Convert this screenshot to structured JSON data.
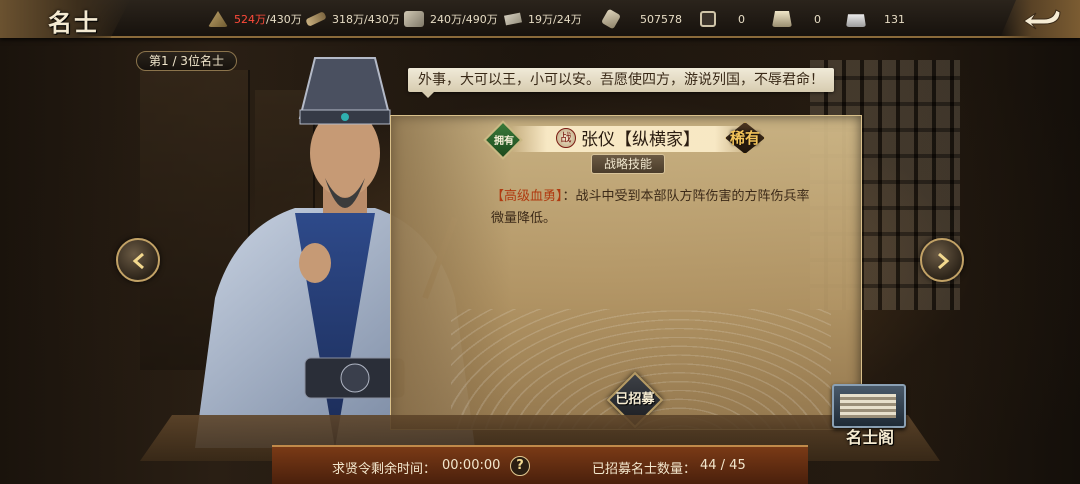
{
  "header": {
    "title": "名士",
    "resources": [
      {
        "icon": "grain-icon",
        "value": "524万",
        "cap": "/430万",
        "over": true
      },
      {
        "icon": "wood-icon",
        "value": "318万",
        "cap": "/430万",
        "over": false
      },
      {
        "icon": "stone-icon",
        "value": "240万",
        "cap": "/490万",
        "over": false
      },
      {
        "icon": "iron-icon",
        "value": "19万",
        "cap": "/24万",
        "over": false
      },
      {
        "icon": "decree-icon",
        "value": "507578",
        "cap": "",
        "over": false
      },
      {
        "icon": "copper-coin-icon",
        "value": "0",
        "cap": "",
        "over": false
      },
      {
        "icon": "gold-ingot-icon",
        "value": "0",
        "cap": "",
        "over": false
      },
      {
        "icon": "silver-ingot-icon",
        "value": "131",
        "cap": "",
        "over": false
      }
    ]
  },
  "index_label": "第1 / 3位名士",
  "quote": "外事，大可以王，小可以安。吾愿使四方，游说列国，不辱君命！",
  "scholar": {
    "owned_label": "拥有",
    "battle_tag": "战",
    "name": "张仪【纵横家】",
    "rarity": "稀有",
    "skill_tab": "战略技能",
    "skill_name": "【高级血勇】",
    "skill_text": "：战斗中受到本部队方阵伤害的方阵伤兵率微量降低。",
    "status": "已招募"
  },
  "footer": {
    "timer_label": "求贤令剩余时间：",
    "timer_value": "00:00:00",
    "help": "?",
    "count_label": "已招募名士数量：",
    "count_value": "44 / 45"
  },
  "pavilion_label": "名士阁",
  "colors": {
    "accent_gold": "#c2a266",
    "warn_red": "#ff4a3a"
  }
}
